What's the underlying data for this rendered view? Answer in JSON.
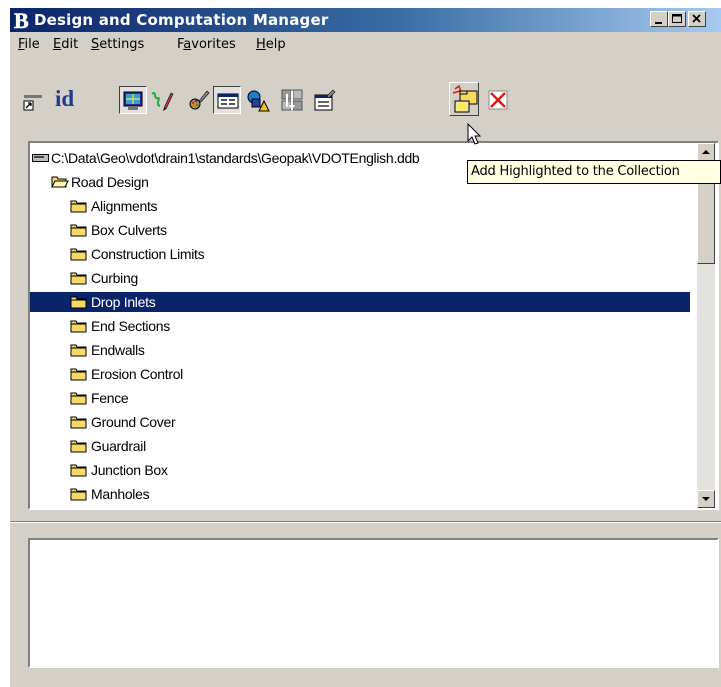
{
  "window": {
    "title": "Design and Computation Manager",
    "app_icon": "microstation-b-icon"
  },
  "title_buttons": [
    {
      "name": "minimize-button",
      "glyph": "_"
    },
    {
      "name": "maximize-button",
      "glyph": "□"
    },
    {
      "name": "close-button",
      "glyph": "×"
    }
  ],
  "menu": [
    {
      "pre": "",
      "key": "F",
      "post": "ile"
    },
    {
      "pre": "",
      "key": "E",
      "post": "dit"
    },
    {
      "pre": "",
      "key": "S",
      "post": "ettings"
    },
    {
      "pre": "F",
      "key": "a",
      "post": "vorites"
    },
    {
      "pre": "",
      "key": "H",
      "post": "elp"
    }
  ],
  "toolbar": {
    "id_label": "id",
    "items": [
      "place-influence-icon",
      "identify-icon",
      "display-mode-icon",
      "draw-mode-icon",
      "design-mode-icon",
      "dialog-mode-icon",
      "shape-mode-icon",
      "navigator-icon",
      "properties-icon",
      "add-highlighted-icon",
      "delete-icon"
    ]
  },
  "tree": {
    "root_path": "C:\\Data\\Geo\\vdot\\drain1\\standards\\Geopak\\VDOTEnglish.ddb",
    "category": "Road Design",
    "items": [
      "Alignments",
      "Box Culverts",
      "Construction Limits",
      "Curbing",
      "Drop Inlets",
      "End Sections",
      "Endwalls",
      "Erosion Control",
      "Fence",
      "Ground Cover",
      "Guardrail",
      "Junction Box",
      "Manholes"
    ],
    "selected": "Drop Inlets"
  },
  "tooltip": "Add Highlighted to the Collection",
  "colors": {
    "titlebar_start": "#0a246a",
    "titlebar_end": "#a6caf0",
    "selection": "#0a246a",
    "window_face": "#d4d0c8",
    "tooltip_bg": "#ffffe1",
    "folder_yellow": "#f7d866"
  }
}
